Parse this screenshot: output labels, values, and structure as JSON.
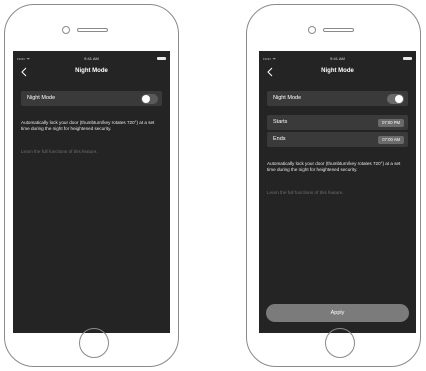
{
  "left_screen": {
    "status": {
      "signal": "••••• ᯤ",
      "time": "9:41 AM"
    },
    "nav": {
      "title": "Night Mode"
    },
    "night_mode": {
      "label": "Night Mode",
      "enabled": false
    },
    "description": "Automatically lock your door (thumbturn/key rotates 720°) at a set time during the night for heightened security.",
    "learn_more": "Learn the full functions of this feature."
  },
  "right_screen": {
    "status": {
      "signal": "••••• ᯤ",
      "time": "9:41 AM"
    },
    "nav": {
      "title": "Night Mode"
    },
    "night_mode": {
      "label": "Night Mode",
      "enabled": true
    },
    "starts": {
      "label": "Starts",
      "value": "07:00 PM"
    },
    "ends": {
      "label": "Ends",
      "value": "07:00 AM"
    },
    "description": "Automatically lock your door (thumbturn/key rotates 720°) at a set time during the night for heightened security.",
    "learn_more": "Learn the full functions of this feature.",
    "apply_label": "Apply"
  }
}
